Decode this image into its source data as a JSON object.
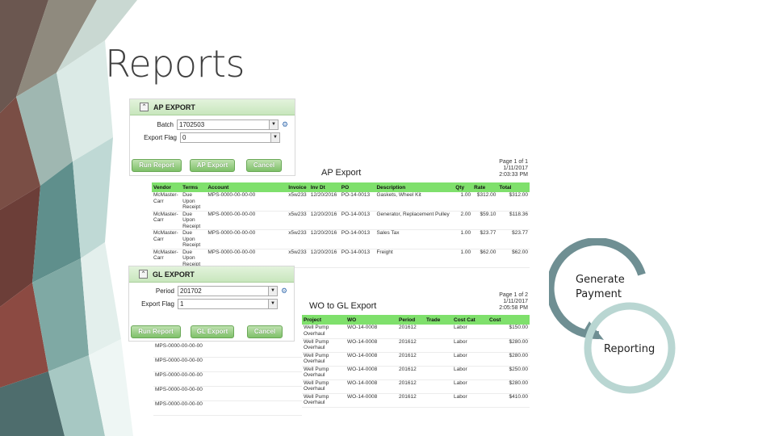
{
  "slide": {
    "title": "Reports"
  },
  "ap_panel": {
    "title": "AP EXPORT",
    "batch_label": "Batch",
    "batch_value": "1702503",
    "export_flag_label": "Export Flag",
    "export_flag_value": "0",
    "buttons": [
      "Run Report",
      "AP Export",
      "Cancel"
    ]
  },
  "ap_report": {
    "title": "AP Export",
    "page_info": [
      "Page 1 of 1",
      "1/11/2017",
      "2:03:33 PM"
    ],
    "columns": [
      "Vendor",
      "Terms",
      "Account",
      "Invoice",
      "Inv Dt",
      "PO",
      "Description",
      "Qty",
      "Rate",
      "Total"
    ],
    "rows": [
      [
        "McMaster-Carr",
        "Due Upon Receipt",
        "MPS-0000-00-00-00",
        "x5w233",
        "12/20/2016",
        "PO-14-0013",
        "Gaskets, Wheel Kit",
        "1.00",
        "$312.00",
        "$312.00"
      ],
      [
        "McMaster-Carr",
        "Due Upon Receipt",
        "MPS-0000-00-00-00",
        "x5w233",
        "12/20/2016",
        "PO-14-0013",
        "Generator, Replacement Pulley",
        "2.00",
        "$59.10",
        "$118.36"
      ],
      [
        "McMaster-Carr",
        "Due Upon Receipt",
        "MPS-0000-00-00-00",
        "x5w233",
        "12/20/2016",
        "PO-14-0013",
        "Sales Tax",
        "1.00",
        "$23.77",
        "$23.77"
      ],
      [
        "McMaster-Carr",
        "Due Upon Receipt",
        "MPS-0000-00-00-00",
        "x5w233",
        "12/20/2016",
        "PO-14-0013",
        "Freight",
        "1.00",
        "$62.00",
        "$62.00"
      ]
    ]
  },
  "gl_panel": {
    "title": "GL EXPORT",
    "period_label": "Period",
    "period_value": "201702",
    "export_flag_label": "Export Flag",
    "export_flag_value": "1",
    "buttons": [
      "Run Report",
      "GL Export",
      "Cancel"
    ]
  },
  "gl_report": {
    "title": "WO to GL Export",
    "page_info": [
      "Page 1 of 2",
      "1/11/2017",
      "2:05:58 PM"
    ],
    "columns": [
      "Project",
      "WO",
      "Period",
      "Trade",
      "Cost Cat",
      "Cost"
    ],
    "account_values": [
      "MPS-0000-00-00-00",
      "MPS-0000-00-00-00",
      "MPS-0000-00-00-00",
      "MPS-0000-00-00-00",
      "MPS-0000-00-00-00"
    ],
    "rows": [
      [
        "Well Pump Overhaul",
        "WO-14-0008",
        "201612",
        "",
        "Labor",
        "$150.00"
      ],
      [
        "Well Pump Overhaul",
        "WO-14-0008",
        "201612",
        "",
        "Labor",
        "$280.00"
      ],
      [
        "Well Pump Overhaul",
        "WO-14-0008",
        "201612",
        "",
        "Labor",
        "$280.00"
      ],
      [
        "Well Pump Overhaul",
        "WO-14-0008",
        "201612",
        "",
        "Labor",
        "$250.00"
      ],
      [
        "Well Pump Overhaul",
        "WO-14-0008",
        "201612",
        "",
        "Labor",
        "$280.00"
      ],
      [
        "Well Pump Overhaul",
        "WO-14-0008",
        "201612",
        "",
        "Labor",
        "$410.00"
      ]
    ]
  },
  "cycle": {
    "step1": "Generate Payment",
    "step2": "Reporting",
    "colors": {
      "dark": "#6f8f93",
      "light": "#b9d6d2"
    }
  }
}
